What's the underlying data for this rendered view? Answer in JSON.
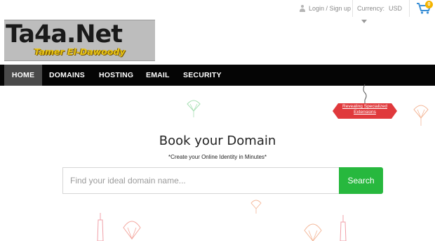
{
  "topbar": {
    "login_label": "Login / Sign up",
    "currency_label": "Currency:",
    "currency_value": "USD",
    "cart_count": "0"
  },
  "logo": {
    "title": "Ta4a.Net",
    "subtitle": "Tamer El-Dawoody"
  },
  "nav": {
    "items": [
      {
        "label": "HOME"
      },
      {
        "label": "DOMAINS"
      },
      {
        "label": "HOSTING"
      },
      {
        "label": "EMAIL"
      },
      {
        "label": "SECURITY"
      }
    ]
  },
  "promo": {
    "line1": "Revealing Specialized",
    "line2": "Extensions"
  },
  "hero": {
    "title": "Book your Domain",
    "tagline": "*Create your Online Identity in Minutes*"
  },
  "search": {
    "placeholder": "Find your ideal domain name...",
    "button_label": "Search"
  },
  "colors": {
    "nav_bg": "#050505",
    "nav_active": "#4a4a4a",
    "search_button": "#27b83e",
    "promo_badge": "#e0393c",
    "cart_icon": "#3a8fd6",
    "cart_badge": "#f4b400"
  }
}
